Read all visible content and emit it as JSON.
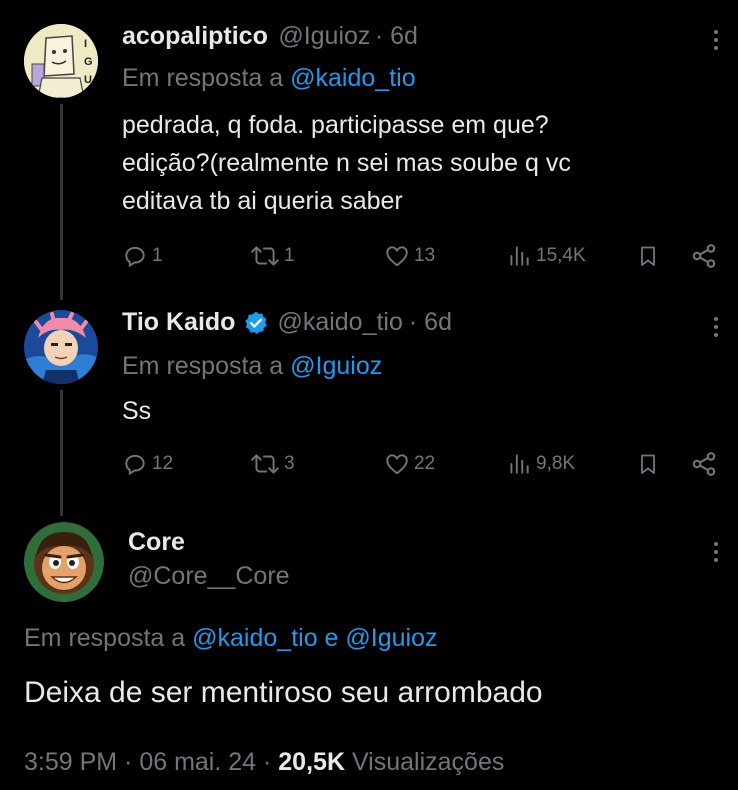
{
  "tweets": [
    {
      "name": "acopaliptico",
      "handle": "@Iguioz",
      "time": "· 6d",
      "reply_prefix": "Em resposta a ",
      "reply_mention": "@kaido_tio",
      "lines": [
        "pedrada, q foda. participasse em que?",
        "edição?(realmente n sei mas soube q vc",
        "editava tb ai queria saber"
      ],
      "replies": "1",
      "retweets": "1",
      "likes": "13",
      "views": "15,4K",
      "avatar_letters": [
        "I",
        "G",
        "U"
      ]
    },
    {
      "name": "Tio Kaido",
      "handle": "@kaido_tio",
      "time": "· 6d",
      "reply_prefix": "Em resposta a ",
      "reply_mention": "@Iguioz",
      "lines": [
        "Ss"
      ],
      "replies": "12",
      "retweets": "3",
      "likes": "22",
      "views": "9,8K"
    }
  ],
  "main_tweet": {
    "name": "Core",
    "handle": "@Core__Core",
    "reply_prefix": "Em resposta a ",
    "mention1": "@kaido_tio",
    "conjunction": " e ",
    "mention2": "@Iguioz",
    "text": "Deixa de ser mentiroso seu arrombado",
    "time": "3:59 PM · 06 mai. 24 · ",
    "views_count": "20,5K",
    "views_label": " Visualizações"
  },
  "colors": {
    "background": "#000000",
    "text": "#e7e9ea",
    "muted": "#71767b",
    "accent": "#1d9bf0"
  }
}
